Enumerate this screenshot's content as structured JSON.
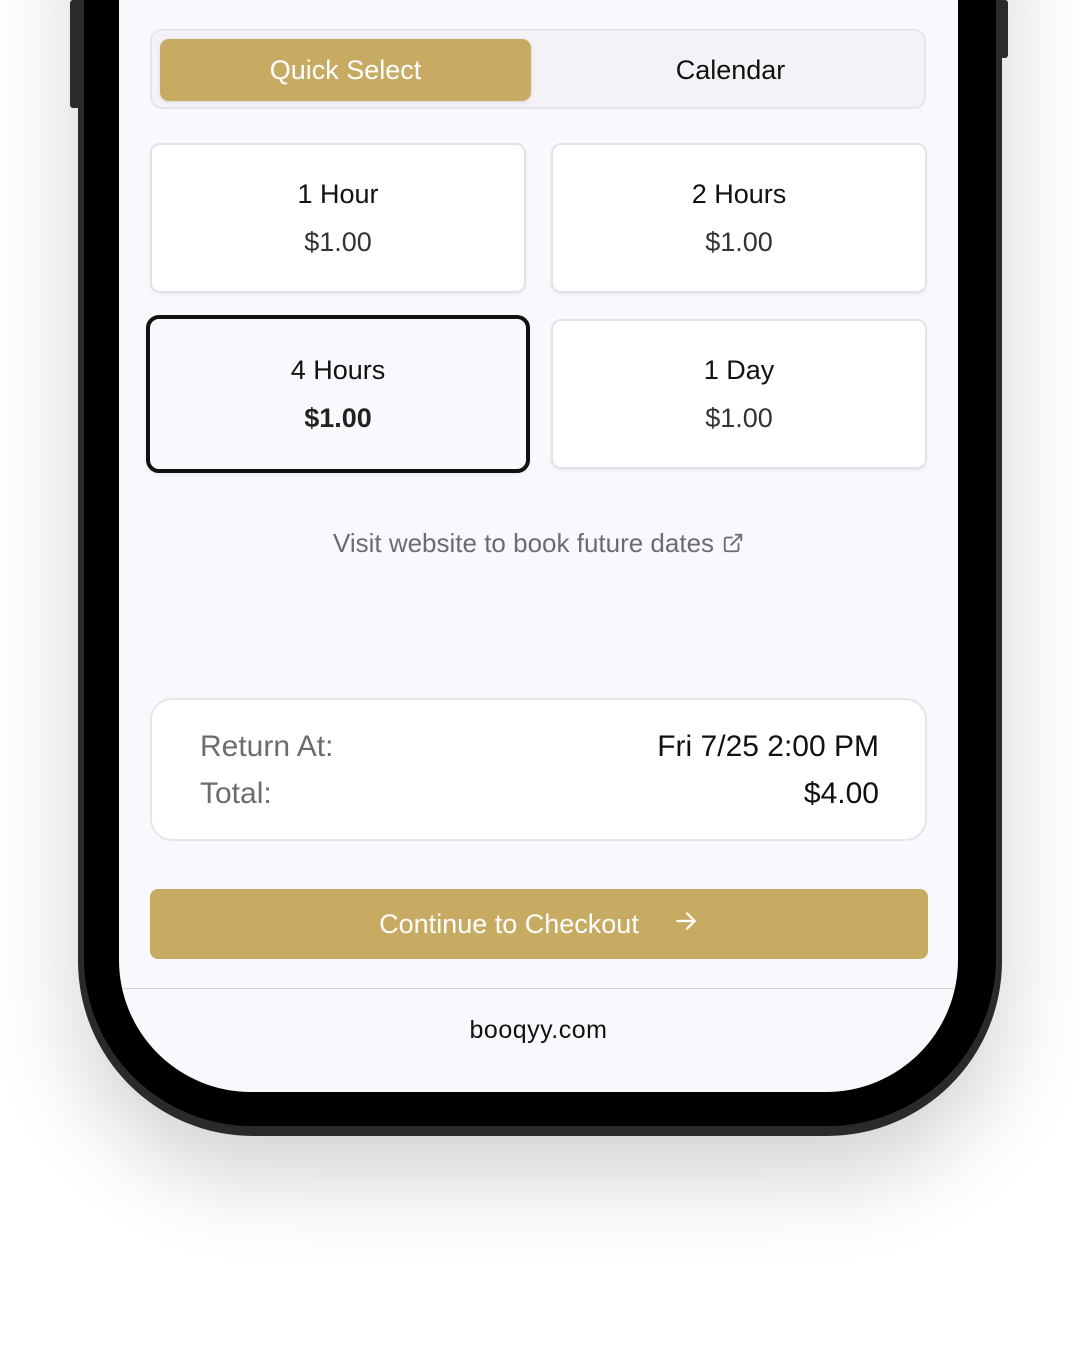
{
  "segmented_control": {
    "options": [
      "Quick Select",
      "Calendar"
    ],
    "selected": "Quick Select"
  },
  "duration_options": [
    {
      "label": "1 Hour",
      "price": "$1.00"
    },
    {
      "label": "2 Hours",
      "price": "$1.00"
    },
    {
      "label": "4 Hours",
      "price": "$1.00"
    },
    {
      "label": "1 Day",
      "price": "$1.00"
    }
  ],
  "selected_option": "4 Hours",
  "visit_link": {
    "text": "Visit website to book future dates",
    "icon": "external-link-icon"
  },
  "summary": {
    "return_label": "Return At:",
    "return_value": "Fri 7/25 2:00 PM",
    "total_label": "Total:",
    "total_value": "$4.00"
  },
  "checkout_button": {
    "label": "Continue to Checkout",
    "icon": "arrow-right-icon"
  },
  "footer": {
    "url": "booqyy.com"
  },
  "colors": {
    "accent": "#c8ab62",
    "screen_background": "#f9f8fc",
    "selected_border": "#111111"
  }
}
